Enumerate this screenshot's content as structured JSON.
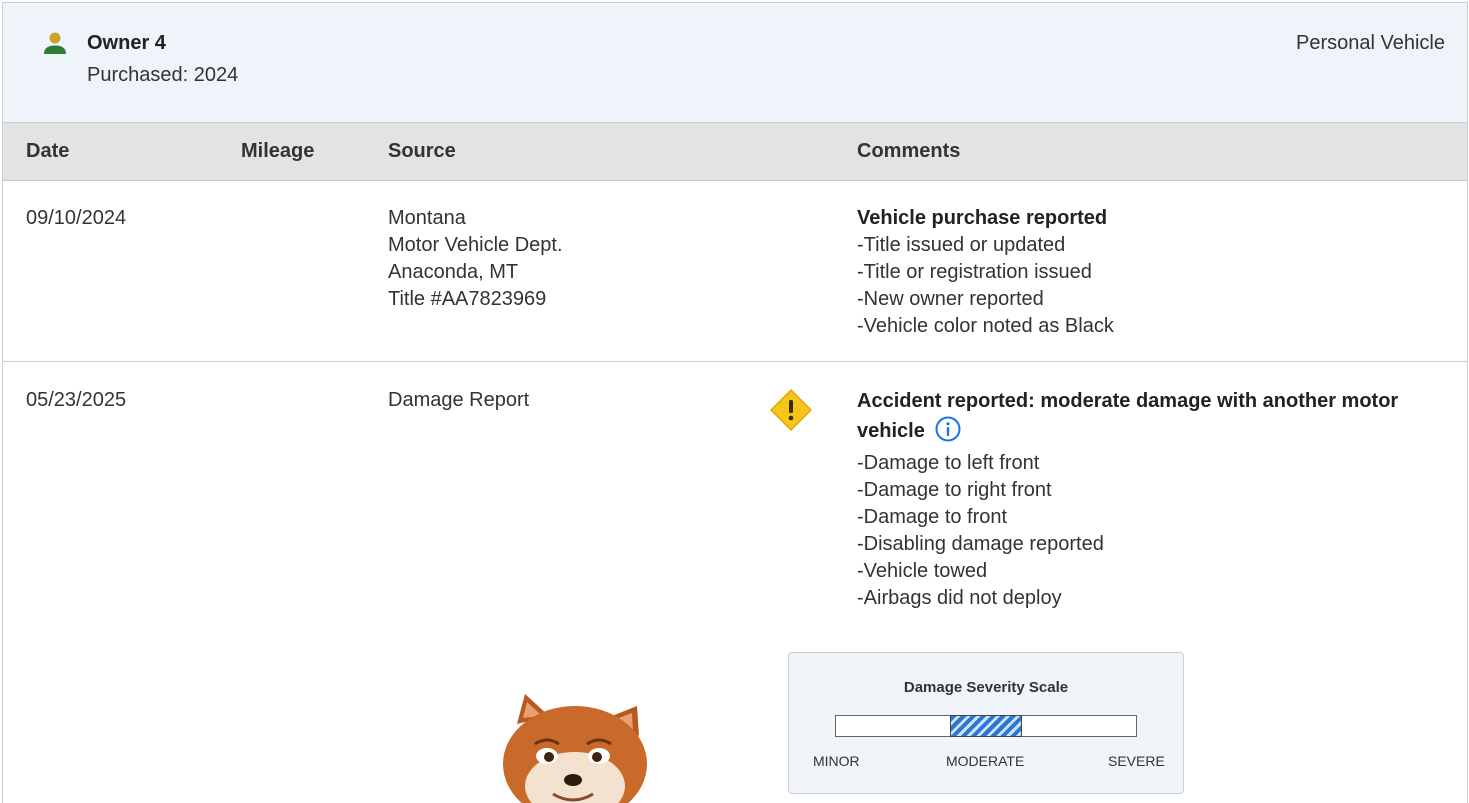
{
  "owner": {
    "title": "Owner 4",
    "purchased": "Purchased: 2024",
    "type": "Personal Vehicle",
    "icon": "person-icon",
    "icon_color": "#2e7d32",
    "icon_head_color": "#c9a227"
  },
  "columns": {
    "date": "Date",
    "mileage": "Mileage",
    "source": "Source",
    "comments": "Comments"
  },
  "records": [
    {
      "date": "09/10/2024",
      "mileage": "",
      "source": [
        "Montana",
        "Motor Vehicle Dept.",
        "Anaconda, MT",
        "Title #AA7823969"
      ],
      "comments_title": "Vehicle purchase reported",
      "comments": [
        "Title issued or updated",
        "Title or registration issued",
        "New owner reported",
        "Vehicle color noted as Black"
      ]
    },
    {
      "date": "05/23/2025",
      "mileage": "",
      "source": [
        "Damage Report"
      ],
      "icon": "warning-icon",
      "comments_title_line1": "Accident reported: moderate damage with another motor",
      "comments_title_line2": "vehicle",
      "info_icon": "info-icon",
      "comments": [
        "Damage to left front",
        "Damage to right front",
        "Damage to front",
        "Disabling damage reported",
        "Vehicle towed",
        "Airbags did not deploy"
      ]
    }
  ],
  "severity_scale": {
    "title": "Damage Severity Scale",
    "labels": [
      "MINOR",
      "MODERATE",
      "SEVERE"
    ],
    "selected": "MODERATE",
    "fill_start_fraction": 0.38,
    "fill_end_fraction": 0.62,
    "fill_color": "#2a78d2"
  },
  "colors": {
    "header_bg": "#eef4fa",
    "column_header_bg": "#e3e3e3",
    "warning": "#f5c518",
    "info": "#1a73e8"
  }
}
